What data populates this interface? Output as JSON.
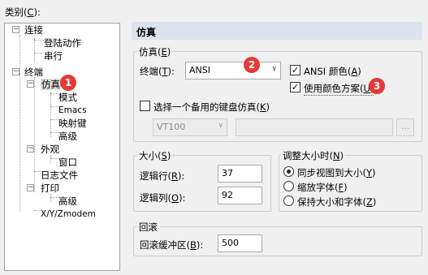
{
  "category_label": {
    "text": "类别(",
    "key": "C",
    "tail": "):"
  },
  "tree": {
    "items": [
      {
        "label": "连接"
      },
      {
        "label": "登陆动作"
      },
      {
        "label": "串行"
      },
      {
        "label": "终端"
      },
      {
        "label": "仿真"
      },
      {
        "label": "模式"
      },
      {
        "label": "Emacs"
      },
      {
        "label": "映射键"
      },
      {
        "label": "高级"
      },
      {
        "label": "外观"
      },
      {
        "label": "窗口"
      },
      {
        "label": "日志文件"
      },
      {
        "label": "打印"
      },
      {
        "label": "高级"
      },
      {
        "label": "X/Y/Zmodem"
      }
    ],
    "expanders": {
      "open": "−"
    }
  },
  "panel": {
    "title": "仿真"
  },
  "emulation": {
    "legend": {
      "text": "仿真(",
      "key": "E",
      "tail": ")"
    },
    "terminal_label": {
      "text": "终端(",
      "key": "T",
      "tail": "):"
    },
    "terminal_value": "ANSI",
    "ansi_color": {
      "text": "ANSI 颜色(",
      "key": "A",
      "tail": ")",
      "checked": "✓"
    },
    "color_scheme": {
      "text": "使用颜色方案(",
      "key": "U",
      "tail": ")",
      "checked": "✓"
    },
    "alt_keyboard": {
      "text": "选择一个备用的键盘仿真(",
      "key": "K",
      "tail": ")"
    },
    "alt_keyboard_value": "VT100",
    "browse_label": "..."
  },
  "size": {
    "legend": {
      "text": "大小(",
      "key": "S",
      "tail": ")"
    },
    "rows": {
      "text": "逻辑行(",
      "key": "R",
      "tail": "):",
      "value": "37"
    },
    "cols": {
      "text": "逻辑列(",
      "key": "O",
      "tail": "):",
      "value": "92"
    }
  },
  "resize": {
    "legend": {
      "text": "调整大小时(",
      "key": "N",
      "tail": ")"
    },
    "options": [
      {
        "text": "同步视图到大小(",
        "key": "Y",
        "tail": ")"
      },
      {
        "text": "缩放字体(",
        "key": "F",
        "tail": ")"
      },
      {
        "text": "保持大小和字体(",
        "key": "Z",
        "tail": ")"
      }
    ]
  },
  "scrollback": {
    "legend": "回滚",
    "buffer": {
      "text": "回滚缓冲区(",
      "key": "B",
      "tail": "):",
      "value": "500"
    }
  },
  "badges": [
    "1",
    "2",
    "3"
  ],
  "arrow": "∨"
}
